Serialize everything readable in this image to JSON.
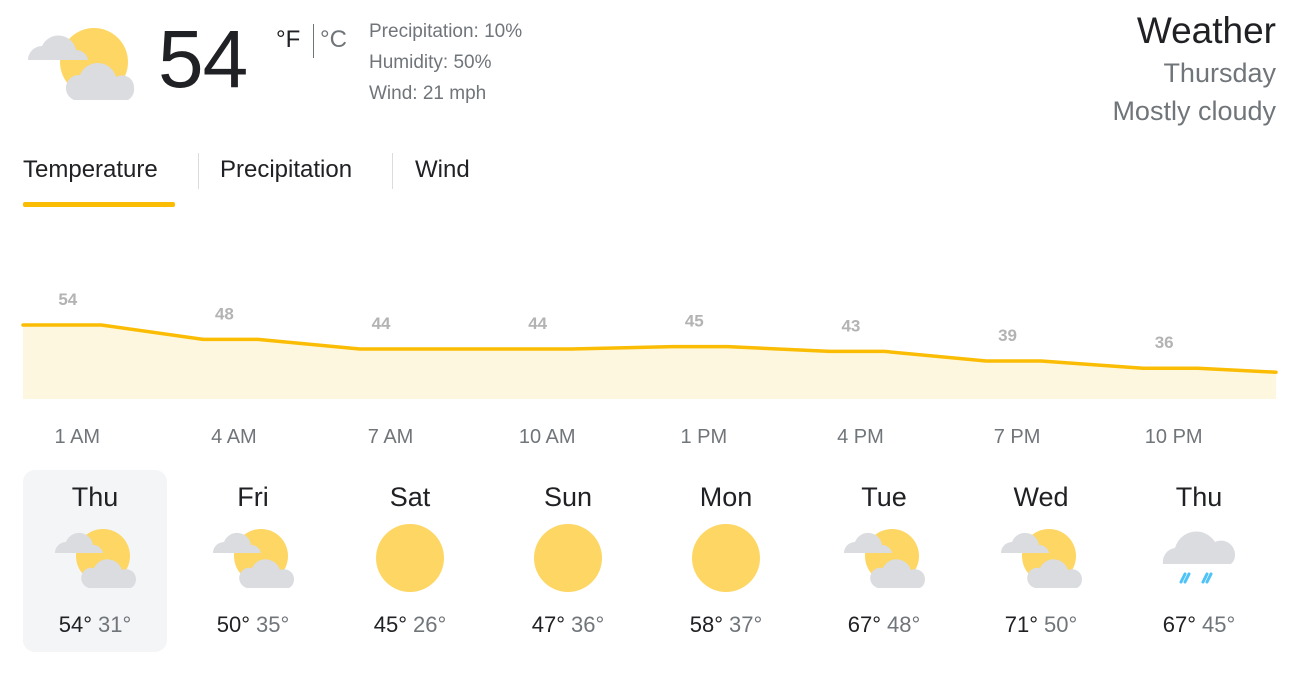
{
  "current": {
    "temperature": "54",
    "unit_f": "°F",
    "unit_c": "°C",
    "icon": "partly-cloudy-icon",
    "precipitation": "Precipitation: 10%",
    "humidity": "Humidity: 50%",
    "wind": "Wind: 21 mph"
  },
  "header": {
    "title": "Weather",
    "day": "Thursday",
    "condition": "Mostly cloudy"
  },
  "tabs": [
    {
      "label": "Temperature",
      "selected": true
    },
    {
      "label": "Precipitation",
      "selected": false
    },
    {
      "label": "Wind",
      "selected": false
    }
  ],
  "colors": {
    "accent": "#fbbc04",
    "chart_fill": "#fef7e0",
    "label_gray": "#70757a"
  },
  "chart_data": {
    "type": "area",
    "x": [
      "1 AM",
      "4 AM",
      "7 AM",
      "10 AM",
      "1 PM",
      "4 PM",
      "7 PM",
      "10 PM"
    ],
    "series": [
      {
        "values": [
          54,
          48,
          44,
          44,
          45,
          43,
          39,
          36
        ]
      }
    ],
    "labels": [
      "54",
      "48",
      "44",
      "44",
      "45",
      "43",
      "39",
      "36"
    ],
    "grid": false
  },
  "forecast": [
    {
      "day": "Thu",
      "icon": "partly-cloudy-icon",
      "high": "54°",
      "low": "31°",
      "selected": true
    },
    {
      "day": "Fri",
      "icon": "partly-cloudy-icon",
      "high": "50°",
      "low": "35°",
      "selected": false
    },
    {
      "day": "Sat",
      "icon": "sunny-icon",
      "high": "45°",
      "low": "26°",
      "selected": false
    },
    {
      "day": "Sun",
      "icon": "sunny-icon",
      "high": "47°",
      "low": "36°",
      "selected": false
    },
    {
      "day": "Mon",
      "icon": "sunny-icon",
      "high": "58°",
      "low": "37°",
      "selected": false
    },
    {
      "day": "Tue",
      "icon": "partly-cloudy-icon",
      "high": "67°",
      "low": "48°",
      "selected": false
    },
    {
      "day": "Wed",
      "icon": "partly-cloudy-icon",
      "high": "71°",
      "low": "50°",
      "selected": false
    },
    {
      "day": "Thu",
      "icon": "showers-icon",
      "high": "67°",
      "low": "45°",
      "selected": false
    }
  ]
}
